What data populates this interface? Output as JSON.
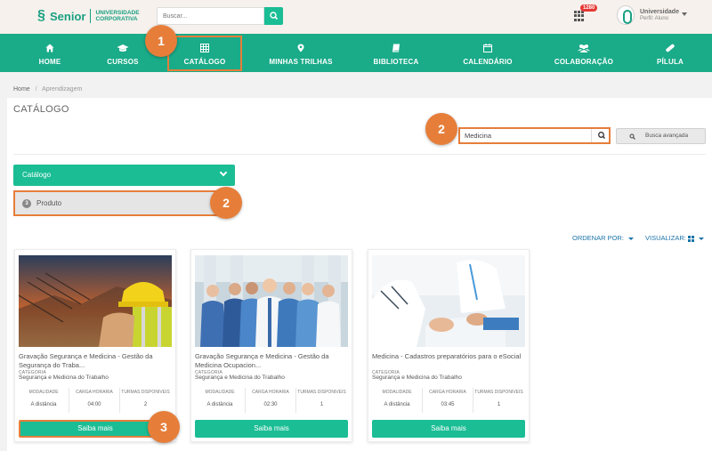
{
  "header": {
    "brand": "Senior",
    "brand_sub_1": "UNIVERSIDADE",
    "brand_sub_2": "CORPORATIVA",
    "search_placeholder": "Buscar...",
    "notifications": "1280",
    "user_name": "Universidade",
    "user_role": "Perfil: Aluno"
  },
  "nav": [
    {
      "label": "HOME",
      "icon": "home-icon"
    },
    {
      "label": "CURSOS",
      "icon": "graduation-cap-icon"
    },
    {
      "label": "CATÁLOGO",
      "icon": "table-icon"
    },
    {
      "label": "MINHAS TRILHAS",
      "icon": "map-marker-icon"
    },
    {
      "label": "BIBLIOTECA",
      "icon": "book-icon"
    },
    {
      "label": "CALENDÁRIO",
      "icon": "calendar-icon"
    },
    {
      "label": "COLABORAÇÃO",
      "icon": "users-icon"
    },
    {
      "label": "PÍLULA",
      "icon": "pill-icon"
    }
  ],
  "steps": {
    "s1": "1",
    "s2a": "2",
    "s2b": "2",
    "s3": "3"
  },
  "breadcrumb": {
    "home": "Home",
    "sep": "/",
    "current": "Aprendizagem"
  },
  "page": {
    "title": "CATÁLOGO"
  },
  "catalog_search": {
    "value": "Medicina",
    "advanced_label": "Busca avançada"
  },
  "filters": {
    "dropdown_label": "Catálogo",
    "produto_count": "3",
    "produto_label": "Produto"
  },
  "toolbar": {
    "sort_label": "ORDENAR POR:",
    "view_label": "VISUALIZAR:"
  },
  "stat_headers": [
    "MODALIDADE",
    "CARGA HORARIA",
    "TURMAS DISPONIVEIS"
  ],
  "cards": [
    {
      "title": "Gravação Segurança e Medicina - Gestão da Segurança do Traba...",
      "category_label": "CATEGORIA",
      "category": "Segurança e Medicina do Trabalho",
      "modalidade": "A distância",
      "carga": "04:00",
      "turmas": "2",
      "button": "Saiba mais"
    },
    {
      "title": "Gravação Segurança e Medicina - Gestão da Medicina Ocupacion...",
      "category_label": "CATEGORIA",
      "category": "Segurança e Medicina do Trabalho",
      "modalidade": "A distância",
      "carga": "02:30",
      "turmas": "1",
      "button": "Saiba mais"
    },
    {
      "title": "Medicina - Cadastros preparatórios para o eSocial",
      "category_label": "CATEGORIA",
      "category": "Segurança e Medicina do Trabalho",
      "modalidade": "A distância",
      "carga": "03:45",
      "turmas": "1",
      "button": "Saiba mais"
    }
  ],
  "colors": {
    "primary": "#1aab89",
    "accent": "#1bbd95",
    "highlight": "#e67e3a",
    "link": "#1a73a8"
  }
}
